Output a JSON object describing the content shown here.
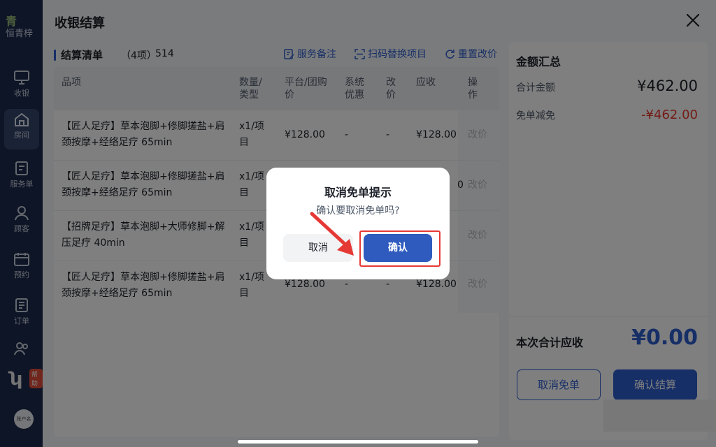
{
  "rail": {
    "brand": "恒青梓",
    "brand_logo": "青",
    "items": [
      {
        "label": "收银",
        "icon": "monitor-icon"
      },
      {
        "label": "房间",
        "icon": "home-icon"
      },
      {
        "label": "服务单",
        "icon": "service-order-icon"
      },
      {
        "label": "顾客",
        "icon": "customer-icon"
      },
      {
        "label": "预约",
        "icon": "calendar-icon"
      },
      {
        "label": "订单",
        "icon": "order-icon"
      },
      {
        "label": "",
        "icon": "staff-icon"
      }
    ],
    "help_badge": "帮助",
    "avatar_text": "账户名"
  },
  "sheet": {
    "title": "收银结算"
  },
  "list": {
    "title": "结算清单",
    "count": "（4项）",
    "code": "514",
    "tools": {
      "remark": "服务备注",
      "scan_replace": "扫码替换项目",
      "reset_price": "重置改价"
    },
    "columns": {
      "item": "品项",
      "qty": "数量/类型",
      "platform_price": "平台/团购价",
      "system_discount": "系统优惠",
      "adjust": "改价",
      "due": "应收",
      "op": "操作"
    },
    "rows": [
      {
        "name": "【匠人足疗】草本泡脚+修脚搓盐+肩颈按摩+经络足疗 65min",
        "qty": "x1/项目",
        "price": "¥128.00",
        "discount": "-",
        "adjust": "-",
        "due": "¥128.00",
        "op": "改价"
      },
      {
        "name": "【匠人足疗】草本泡脚+修脚搓盐+肩颈按摩+经络足疗 65min",
        "qty": "x1/项目",
        "price": "",
        "discount": "",
        "adjust": "",
        "due": "0",
        "op": "改价"
      },
      {
        "name": "【招牌足疗】草本泡脚+大师修脚+解压足疗 40min",
        "qty": "x1/项目",
        "price": "",
        "discount": "",
        "adjust": "",
        "due": "",
        "op": "改价"
      },
      {
        "name": "【匠人足疗】草本泡脚+修脚搓盐+肩颈按摩+经络足疗 65min",
        "qty": "x1/项目",
        "price": "¥128.00",
        "discount": "-",
        "adjust": "-",
        "due": "¥128.00",
        "op": "改价"
      }
    ]
  },
  "summary": {
    "title": "金额汇总",
    "total_label": "合计金额",
    "total_value": "¥462.00",
    "free_label": "免单减免",
    "free_value": "-¥462.00",
    "due_label": "本次合计应收",
    "due_value": "¥0.00",
    "cancel_free_label": "取消免单",
    "confirm_pay_label": "确认结算"
  },
  "dialog": {
    "title": "取消免单提示",
    "message": "确认要取消免单吗?",
    "cancel_label": "取消",
    "ok_label": "确认"
  },
  "colors": {
    "accent": "#2f5ecf",
    "danger": "#e8362c",
    "annotation": "#e53935"
  }
}
